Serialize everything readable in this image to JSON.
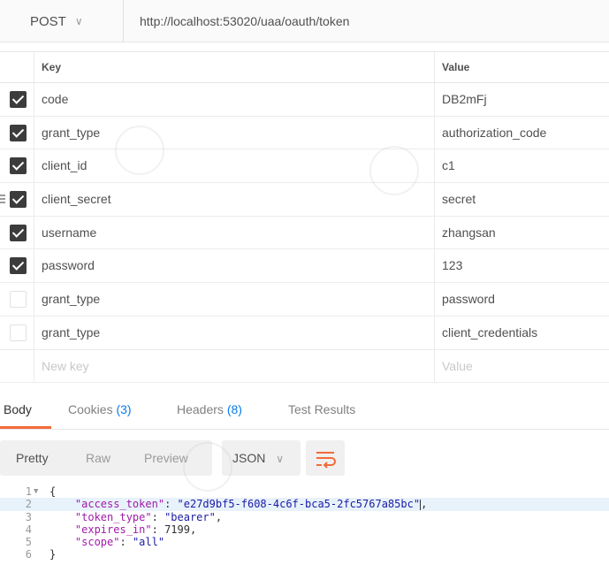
{
  "request": {
    "method": "POST",
    "url": "http://localhost:53020/uaa/oauth/token"
  },
  "params": {
    "header_key": "Key",
    "header_value": "Value",
    "rows": [
      {
        "checked": true,
        "key": "code",
        "value": "DB2mFj"
      },
      {
        "checked": true,
        "key": "grant_type",
        "value": "authorization_code"
      },
      {
        "checked": true,
        "key": "client_id",
        "value": "c1"
      },
      {
        "checked": true,
        "key": "client_secret",
        "value": "secret"
      },
      {
        "checked": true,
        "key": "username",
        "value": "zhangsan"
      },
      {
        "checked": true,
        "key": "password",
        "value": "123"
      },
      {
        "checked": false,
        "key": "grant_type",
        "value": "password"
      },
      {
        "checked": false,
        "key": "grant_type",
        "value": "client_credentials"
      }
    ],
    "new_key_placeholder": "New key",
    "new_value_placeholder": "Value"
  },
  "response_tabs": {
    "body": "Body",
    "cookies": "Cookies",
    "cookies_count": "(3)",
    "headers": "Headers",
    "headers_count": "(8)",
    "test_results": "Test Results"
  },
  "format": {
    "pretty": "Pretty",
    "raw": "Raw",
    "preview": "Preview",
    "language": "JSON"
  },
  "body_lines": [
    "1",
    "2",
    "3",
    "4",
    "5",
    "6"
  ],
  "body": {
    "access_token_key": "\"access_token\"",
    "access_token_value": "\"e27d9bf5-f608-4c6f-bca5-2fc5767a85bc\"",
    "token_type_key": "\"token_type\"",
    "token_type_value": "\"bearer\"",
    "expires_in_key": "\"expires_in\"",
    "expires_in_value": "7199",
    "scope_key": "\"scope\"",
    "scope_value": "\"all\""
  },
  "colors": {
    "accent": "#f26b3a",
    "count": "#097bed",
    "json_key": "#a11aa8",
    "json_string": "#1a1aa6"
  }
}
